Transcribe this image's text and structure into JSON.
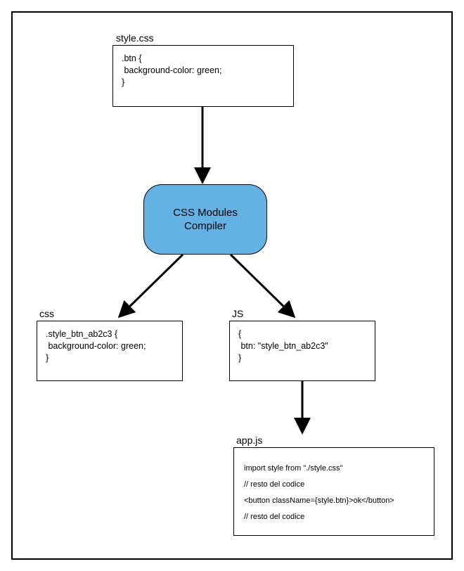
{
  "boxes": {
    "stylecss": {
      "label": "style.css",
      "content": ".btn {\n background-color: green;\n}"
    },
    "compiler": {
      "line1": "CSS Modules",
      "line2": "Compiler"
    },
    "css": {
      "label": "css",
      "content": ".style_btn_ab2c3 {\n background-color: green;\n}"
    },
    "js": {
      "label": "JS",
      "content": "{\n btn: \"style_btn_ab2c3\"\n}"
    },
    "appjs": {
      "label": "app.js",
      "lines": [
        "import style from \"./style.css\"",
        "// resto del codice",
        "<button className={style.btn}>ok</button>",
        "// resto del codice"
      ]
    }
  },
  "chart_data": {
    "type": "diagram",
    "title": "CSS Modules Compiler flow",
    "nodes": [
      {
        "id": "stylecss",
        "label": "style.css",
        "kind": "code-file",
        "content": ".btn { background-color: green; }"
      },
      {
        "id": "compiler",
        "label": "CSS Modules Compiler",
        "kind": "process"
      },
      {
        "id": "css",
        "label": "css",
        "kind": "code-output",
        "content": ".style_btn_ab2c3 { background-color: green; }"
      },
      {
        "id": "js",
        "label": "JS",
        "kind": "code-output",
        "content": "{ btn: \"style_btn_ab2c3\" }"
      },
      {
        "id": "appjs",
        "label": "app.js",
        "kind": "code-file",
        "content": "import style from \"./style.css\"; // resto del codice; <button className={style.btn}>ok</button>; // resto del codice"
      }
    ],
    "edges": [
      {
        "from": "stylecss",
        "to": "compiler"
      },
      {
        "from": "compiler",
        "to": "css"
      },
      {
        "from": "compiler",
        "to": "js"
      },
      {
        "from": "js",
        "to": "appjs"
      }
    ]
  }
}
